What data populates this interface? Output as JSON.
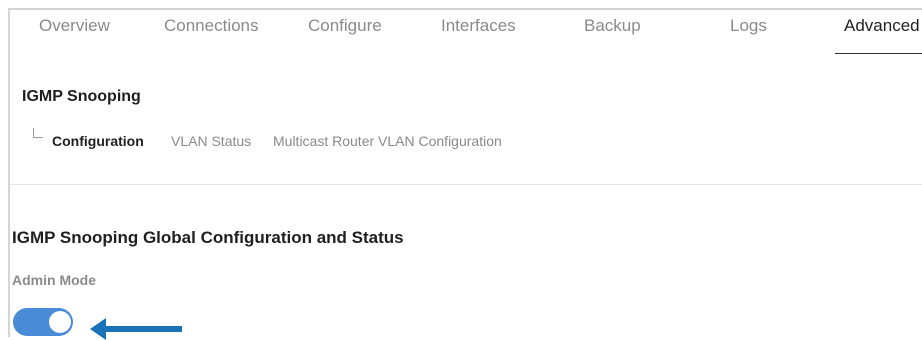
{
  "tabs": [
    {
      "label": "Overview"
    },
    {
      "label": "Connections"
    },
    {
      "label": "Configure"
    },
    {
      "label": "Interfaces"
    },
    {
      "label": "Backup"
    },
    {
      "label": "Logs"
    },
    {
      "label": "Advanced",
      "active": true
    }
  ],
  "section": {
    "title": "IGMP Snooping",
    "subtabs": [
      {
        "label": "Configuration",
        "active": true
      },
      {
        "label": "VLAN Status"
      },
      {
        "label": "Multicast Router VLAN Configuration"
      }
    ]
  },
  "global": {
    "title": "IGMP Snooping Global Configuration and Status",
    "admin_mode_label": "Admin Mode",
    "admin_mode_enabled": true
  },
  "colors": {
    "accent": "#4a8bd8",
    "arrow": "#1a73b8"
  }
}
